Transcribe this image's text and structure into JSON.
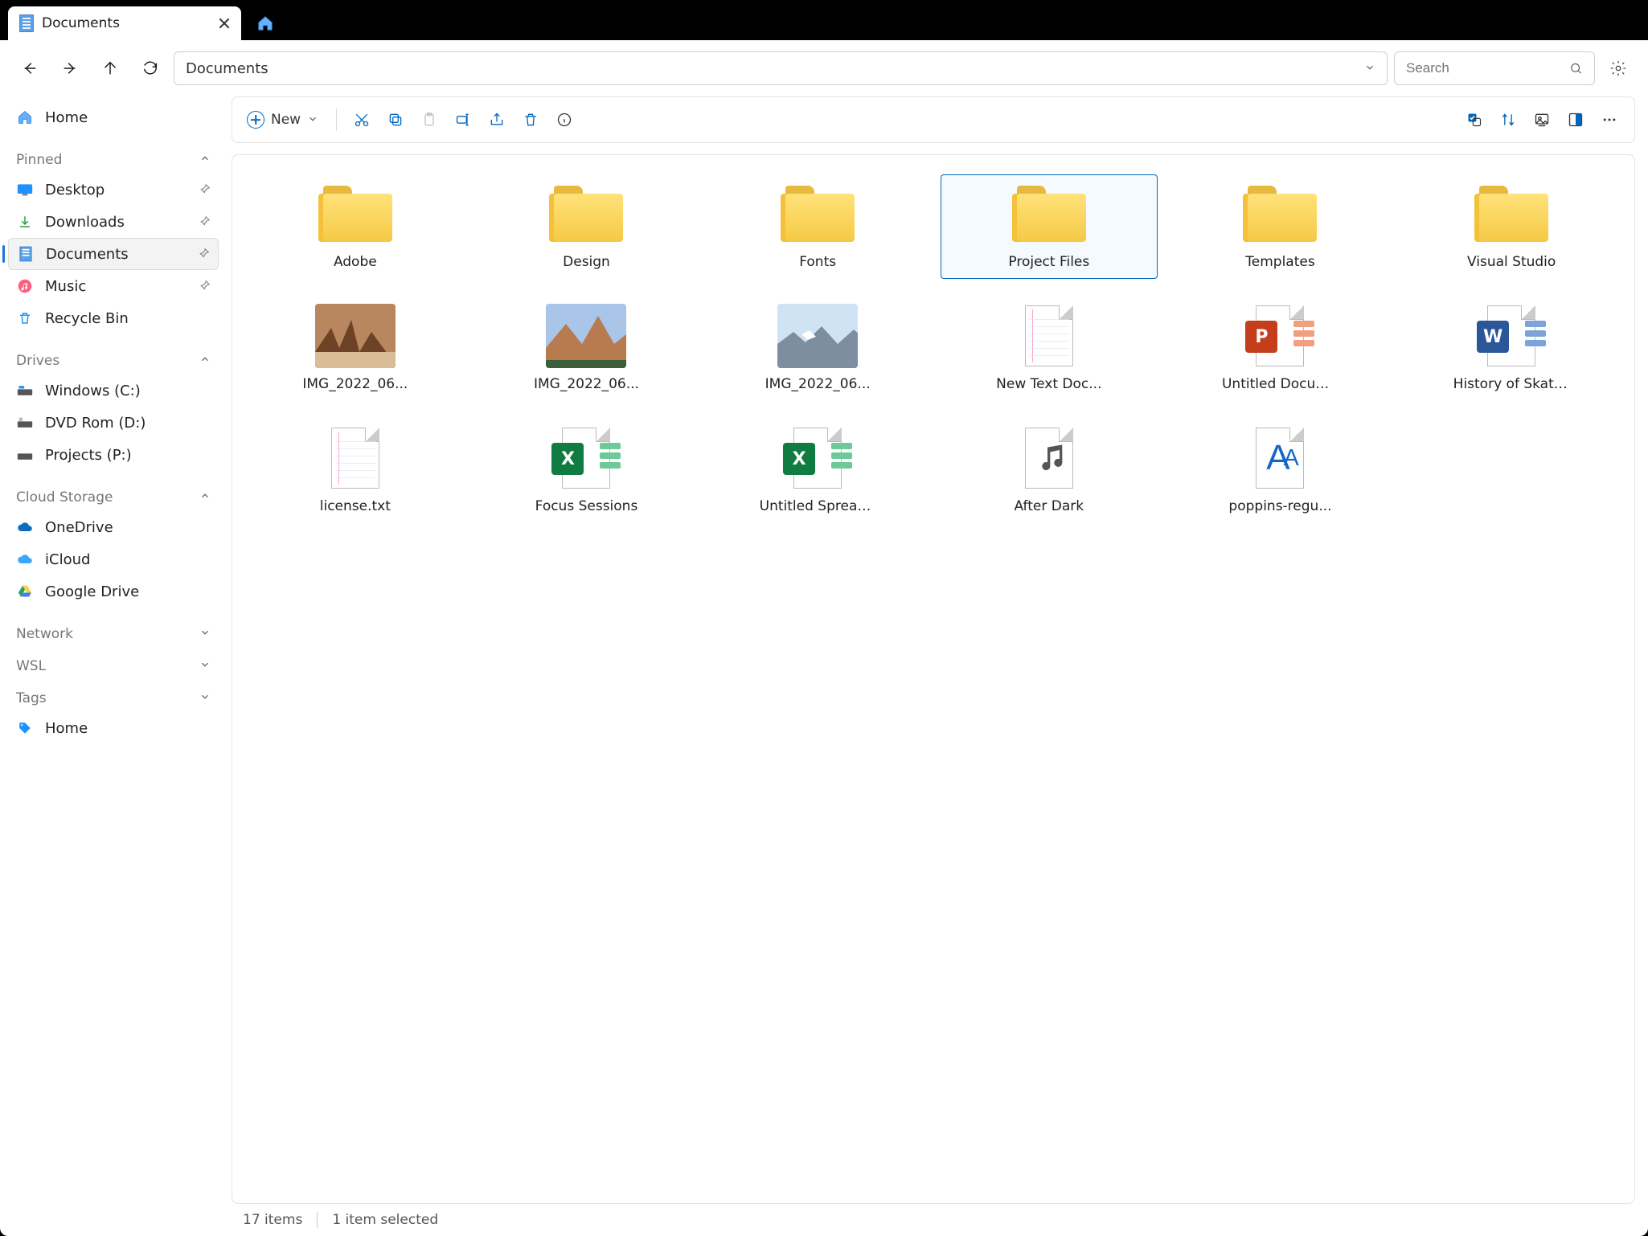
{
  "tab": {
    "title": "Documents"
  },
  "address": {
    "path": "Documents"
  },
  "search": {
    "placeholder": "Search"
  },
  "toolbar": {
    "new_label": "New"
  },
  "sidebar": {
    "home": "Home",
    "groups": {
      "pinned": {
        "label": "Pinned",
        "items": [
          "Desktop",
          "Downloads",
          "Documents",
          "Music",
          "Recycle Bin"
        ],
        "active_index": 2
      },
      "drives": {
        "label": "Drives",
        "items": [
          "Windows (C:)",
          "DVD Rom (D:)",
          "Projects (P:)"
        ]
      },
      "cloud": {
        "label": "Cloud Storage",
        "items": [
          "OneDrive",
          "iCloud",
          "Google Drive"
        ]
      },
      "network": {
        "label": "Network"
      },
      "wsl": {
        "label": "WSL"
      },
      "tags": {
        "label": "Tags",
        "items": [
          "Home"
        ]
      }
    }
  },
  "files": {
    "selected_index": 3,
    "items": [
      {
        "name": "Adobe",
        "type": "folder"
      },
      {
        "name": "Design",
        "type": "folder"
      },
      {
        "name": "Fonts",
        "type": "folder"
      },
      {
        "name": "Project Files",
        "type": "folder"
      },
      {
        "name": "Templates",
        "type": "folder"
      },
      {
        "name": "Visual Studio",
        "type": "folder"
      },
      {
        "name": "IMG_2022_06...",
        "type": "image"
      },
      {
        "name": "IMG_2022_06...",
        "type": "image"
      },
      {
        "name": "IMG_2022_06...",
        "type": "image"
      },
      {
        "name": "New Text Doc...",
        "type": "text"
      },
      {
        "name": "Untitled Docum...",
        "type": "powerpoint"
      },
      {
        "name": "History of Skate...",
        "type": "word"
      },
      {
        "name": "license.txt",
        "type": "text"
      },
      {
        "name": "Focus Sessions",
        "type": "excel"
      },
      {
        "name": "Untitled Spreads...",
        "type": "excel"
      },
      {
        "name": "After Dark",
        "type": "audio"
      },
      {
        "name": "poppins-regu...",
        "type": "font"
      }
    ]
  },
  "status": {
    "count": "17 items",
    "selection": "1 item selected"
  }
}
